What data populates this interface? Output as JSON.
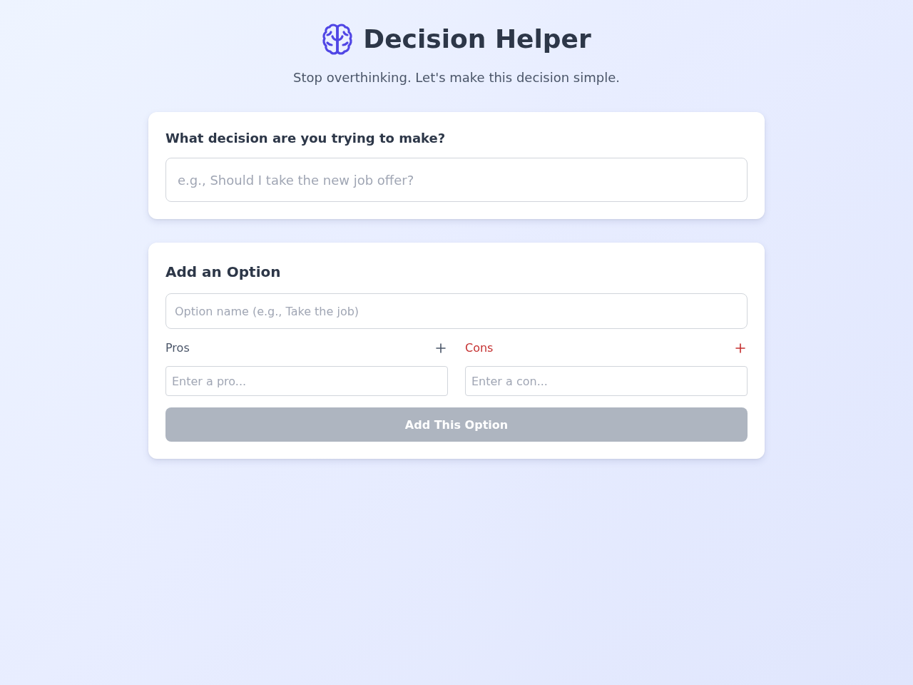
{
  "header": {
    "title": "Decision Helper",
    "subtitle": "Stop overthinking. Let's make this decision simple."
  },
  "decision_card": {
    "label": "What decision are you trying to make?",
    "input": {
      "placeholder": "e.g., Should I take the new job offer?"
    }
  },
  "option_card": {
    "heading": "Add an Option",
    "name_input": {
      "placeholder": "Option name (e.g., Take the job)"
    },
    "lists": [
      {
        "label": "Pros",
        "color": "#4a5568",
        "input": {
          "placeholder": "Enter a pro..."
        }
      },
      {
        "label": "Cons",
        "color": "#c53030",
        "input": {
          "placeholder": "Enter a con..."
        }
      }
    ],
    "submit_button": {
      "label": "Add This Option",
      "disabled": true
    }
  }
}
